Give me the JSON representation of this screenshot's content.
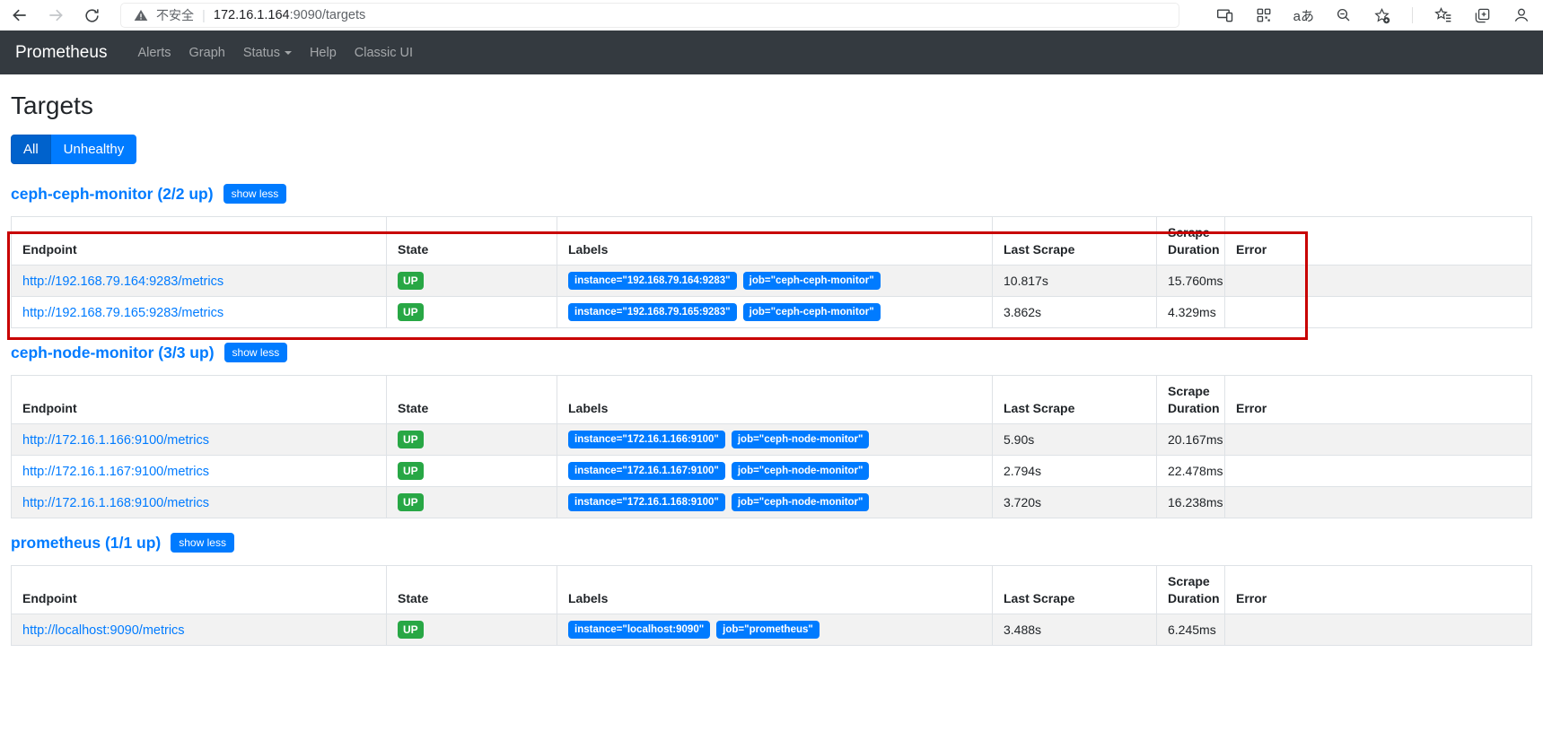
{
  "browser": {
    "security_label": "不安全",
    "url_host": "172.16.1.164",
    "url_path": ":9090/targets",
    "separator": "|",
    "icons": {
      "warning": "!",
      "translate": "aあ"
    }
  },
  "navbar": {
    "brand": "Prometheus",
    "items": [
      {
        "label": "Alerts"
      },
      {
        "label": "Graph"
      },
      {
        "label": "Status"
      },
      {
        "label": "Help"
      },
      {
        "label": "Classic UI"
      }
    ]
  },
  "page": {
    "title": "Targets",
    "filters": {
      "all": "All",
      "unhealthy": "Unhealthy"
    }
  },
  "table_headers": {
    "endpoint": "Endpoint",
    "state": "State",
    "labels": "Labels",
    "last_scrape": "Last Scrape",
    "scrape_duration": "Scrape Duration",
    "error": "Error"
  },
  "groups": [
    {
      "name": "ceph-ceph-monitor (2/2 up)",
      "toggle_label": "show less",
      "targets": [
        {
          "endpoint": "http://192.168.79.164:9283/metrics",
          "state": "UP",
          "labels": [
            "instance=\"192.168.79.164:9283\"",
            "job=\"ceph-ceph-monitor\""
          ],
          "last_scrape": "10.817s",
          "scrape_duration": "15.760ms",
          "error": ""
        },
        {
          "endpoint": "http://192.168.79.165:9283/metrics",
          "state": "UP",
          "labels": [
            "instance=\"192.168.79.165:9283\"",
            "job=\"ceph-ceph-monitor\""
          ],
          "last_scrape": "3.862s",
          "scrape_duration": "4.329ms",
          "error": ""
        }
      ]
    },
    {
      "name": "ceph-node-monitor (3/3 up)",
      "toggle_label": "show less",
      "targets": [
        {
          "endpoint": "http://172.16.1.166:9100/metrics",
          "state": "UP",
          "labels": [
            "instance=\"172.16.1.166:9100\"",
            "job=\"ceph-node-monitor\""
          ],
          "last_scrape": "5.90s",
          "scrape_duration": "20.167ms",
          "error": ""
        },
        {
          "endpoint": "http://172.16.1.167:9100/metrics",
          "state": "UP",
          "labels": [
            "instance=\"172.16.1.167:9100\"",
            "job=\"ceph-node-monitor\""
          ],
          "last_scrape": "2.794s",
          "scrape_duration": "22.478ms",
          "error": ""
        },
        {
          "endpoint": "http://172.16.1.168:9100/metrics",
          "state": "UP",
          "labels": [
            "instance=\"172.16.1.168:9100\"",
            "job=\"ceph-node-monitor\""
          ],
          "last_scrape": "3.720s",
          "scrape_duration": "16.238ms",
          "error": ""
        }
      ]
    },
    {
      "name": "prometheus (1/1 up)",
      "toggle_label": "show less",
      "targets": [
        {
          "endpoint": "http://localhost:9090/metrics",
          "state": "UP",
          "labels": [
            "instance=\"localhost:9090\"",
            "job=\"prometheus\""
          ],
          "last_scrape": "3.488s",
          "scrape_duration": "6.245ms",
          "error": ""
        }
      ]
    }
  ],
  "colors": {
    "accent": "#007bff",
    "up_badge": "#28a745",
    "navbar_bg": "#343a40",
    "annotation_red": "#c80000",
    "row_stripe": "#f2f2f2",
    "table_border": "#dee2e6"
  }
}
